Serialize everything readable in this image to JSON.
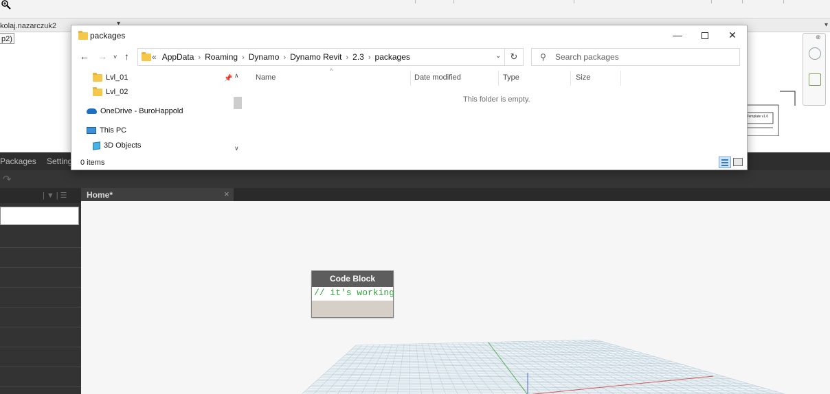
{
  "revit": {
    "user_tab": "kolaj.nazarczuk2",
    "sub_label": "p2)",
    "template_label": "Template v1.0"
  },
  "explorer": {
    "title": "packages",
    "breadcrumb": [
      "AppData",
      "Roaming",
      "Dynamo",
      "Dynamo Revit",
      "2.3",
      "packages"
    ],
    "breadcrumb_prefix": "«",
    "search_placeholder": "Search packages",
    "nav_items": [
      {
        "label": "Lvl_01",
        "icon": "folder-icon"
      },
      {
        "label": "Lvl_02",
        "icon": "folder-icon"
      },
      {
        "label": "OneDrive - BuroHappold",
        "icon": "onedrive-icon"
      },
      {
        "label": "This PC",
        "icon": "pc-icon"
      },
      {
        "label": "3D Objects",
        "icon": "3d-objects-icon"
      }
    ],
    "columns": [
      "Name",
      "Date modified",
      "Type",
      "Size"
    ],
    "empty_message": "This folder is empty.",
    "item_count": "0 items"
  },
  "dynamo": {
    "menu": [
      "Packages",
      "Settings"
    ],
    "workspace_tab": "Home*",
    "node": {
      "title": "Code Block",
      "code": "// it's working"
    }
  },
  "icons": {
    "folder": "folder-icon",
    "pin": "pin-icon",
    "search": "search-icon",
    "refresh": "refresh-icon",
    "minimize": "minimize-icon",
    "maximize": "maximize-icon",
    "close": "close-icon"
  },
  "colors": {
    "folder": "#f5c84c",
    "code_text": "#2e9f3a",
    "dynamo_dark": "#2e2e2e",
    "node_header": "#5d5d5d",
    "node_body": "#d5cfc8"
  }
}
